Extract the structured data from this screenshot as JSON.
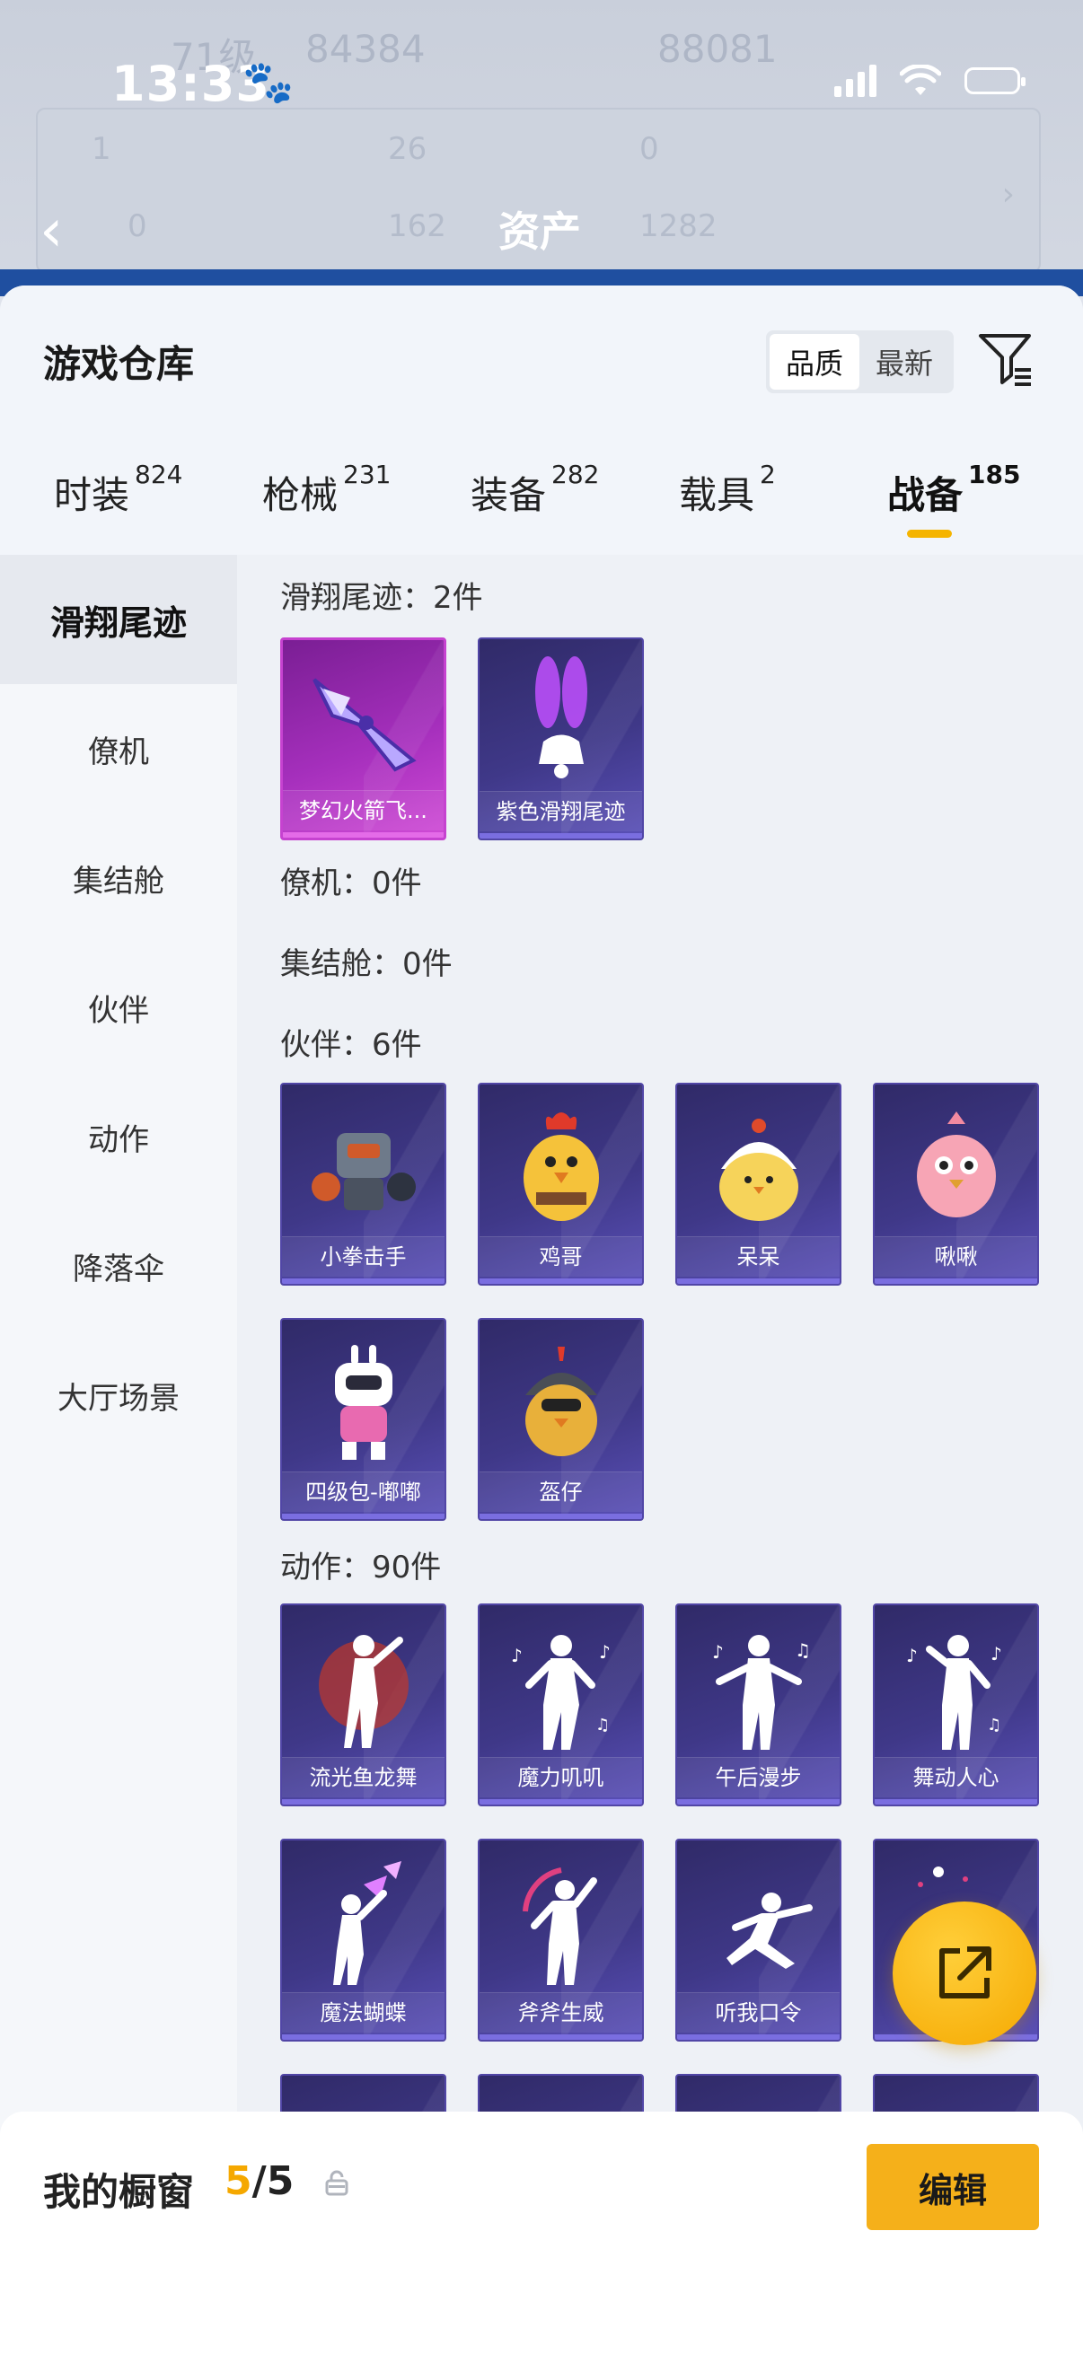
{
  "status_bar": {
    "time": "13:33"
  },
  "background": {
    "title": "资产"
  },
  "sheet": {
    "title": "游戏仓库",
    "sort": {
      "quality": "品质",
      "newest": "最新"
    },
    "tabs": [
      {
        "label": "时装",
        "count": "824"
      },
      {
        "label": "枪械",
        "count": "231"
      },
      {
        "label": "装备",
        "count": "282"
      },
      {
        "label": "载具",
        "count": "2"
      },
      {
        "label": "战备",
        "count": "185"
      }
    ],
    "sidebar": [
      "滑翔尾迹",
      "僚机",
      "集结舱",
      "伙伴",
      "动作",
      "降落伞",
      "大厅场景"
    ],
    "sections": {
      "glide": {
        "label": "滑翔尾迹：2件",
        "items": [
          "梦幻火箭飞...",
          "紫色滑翔尾迹"
        ]
      },
      "wingman": {
        "label": "僚机：0件"
      },
      "capsule": {
        "label": "集结舱：0件"
      },
      "partner": {
        "label": "伙伴：6件",
        "items": [
          "小拳击手",
          "鸡哥",
          "呆呆",
          "啾啾",
          "四级包-嘟嘟",
          "盔仔"
        ]
      },
      "emote": {
        "label": "动作：90件",
        "items": [
          "流光鱼龙舞",
          "魔力叽叽",
          "午后漫步",
          "舞动人心",
          "魔法蝴蝶",
          "斧斧生威",
          "听我口令"
        ]
      }
    }
  },
  "bottom_bar": {
    "label": "我的橱窗",
    "count_current": "5",
    "count_total": "/5",
    "edit_label": "编辑"
  },
  "colors": {
    "accent": "#f5b400",
    "card_rare": "#3f3888",
    "card_epic": "#a52fbc"
  }
}
